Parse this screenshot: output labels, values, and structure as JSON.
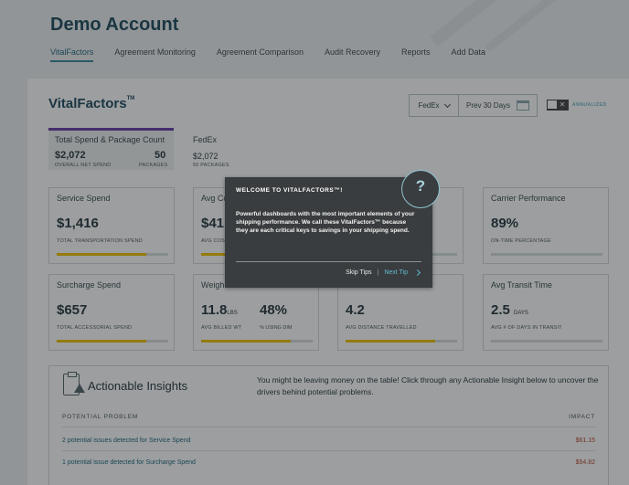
{
  "account": {
    "title": "Demo Account"
  },
  "nav": [
    {
      "label": "VitalFactors",
      "active": true
    },
    {
      "label": "Agreement Monitoring"
    },
    {
      "label": "Agreement Comparison"
    },
    {
      "label": "Audit Recovery"
    },
    {
      "label": "Reports"
    },
    {
      "label": "Add Data"
    }
  ],
  "vital": {
    "title": "VitalFactors",
    "tm": "TM",
    "carrier_select": "FedEx",
    "period_select": "Prev 30 Days",
    "annualized_label": "ANNUALIZED",
    "toggle_off_glyph": "✕"
  },
  "summary_tabs": [
    {
      "label": "Total Spend & Package Count",
      "spend": "$2,072",
      "spend_label": "OVERALL NET SPEND",
      "packages": "50",
      "packages_label": "PACKAGES"
    },
    {
      "label": "FedEx",
      "spend": "$2,072",
      "packages_text": "50 PACKAGES"
    }
  ],
  "metrics": [
    {
      "title": "Service Spend",
      "value": "$1,416",
      "sub": "TOTAL TRANSPORTATION SPEND",
      "fill": 0.8
    },
    {
      "title": "Avg Co",
      "value": "$41.",
      "sub": "AVG COS",
      "fill": 0.5
    },
    {
      "title": "",
      "value": "",
      "sub": "D",
      "fill": 0.0
    },
    {
      "title": "Carrier Performance",
      "value": "89%",
      "sub": "ON-TIME PERCENTAGE",
      "fill": 0.0
    },
    {
      "title": "Surcharge Spend",
      "value": "$657",
      "sub": "TOTAL ACCESSORIAL SPEND",
      "fill": 0.8
    },
    {
      "title": "Weigh",
      "value": "11.8",
      "unit": "LBS",
      "sub": "AVG BILLED WT",
      "value2": "48%",
      "sub2": "% USING DIM",
      "fill": 0.8
    },
    {
      "title": "",
      "value": "4.2",
      "sub": "AVG DISTANCE TRAVELLED",
      "fill": 0.8
    },
    {
      "title": "Avg Transit Time",
      "value": "2.5",
      "unit": "DAYS",
      "sub": "AVG # OF DAYS IN TRANSIT",
      "fill": 0.0
    }
  ],
  "insights": {
    "title": "Actionable Insights",
    "description": "You might be leaving money on the table! Click through any Actionable Insight below to uncover the drivers behind potential problems.",
    "col_problem": "POTENTIAL PROBLEM",
    "col_impact": "IMPACT",
    "rows": [
      {
        "problem": "2 potential issues detected for Service Spend",
        "impact": "$61.15"
      },
      {
        "problem": "1 potential issue detected for Surcharge Spend",
        "impact": "$54.82"
      }
    ]
  },
  "modal": {
    "title": "WELCOME TO VITALFACTORS™!",
    "body": "Powerful dashboards with the most important elements of your shipping performance. We call these VitalFactors™ because they are each critical keys to savings in your shipping spend.",
    "skip_label": "Skip Tips",
    "separator": "|",
    "next_label": "Next Tip",
    "help_glyph": "?"
  },
  "colors": {
    "accent": "#5fb9cf",
    "purple": "#6b3fa8",
    "bar_fill": "#f2c300",
    "impact": "#b5472c"
  }
}
